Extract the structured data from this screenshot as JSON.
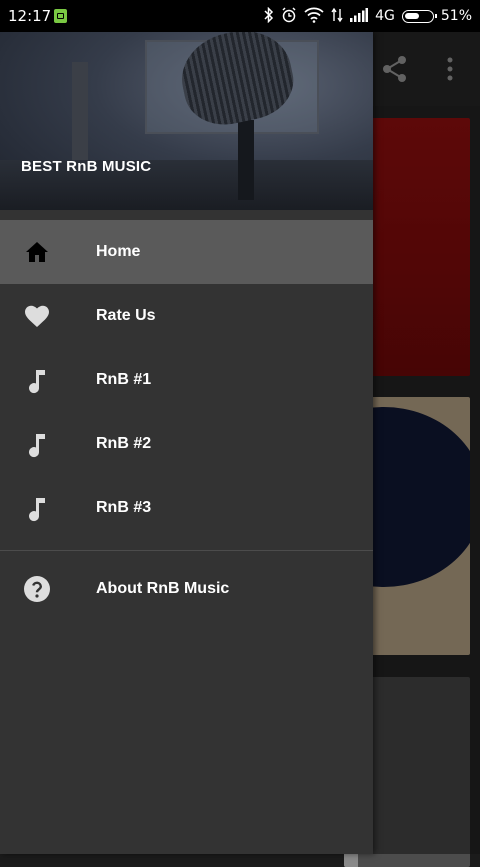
{
  "status_bar": {
    "time": "12:17",
    "network": "4G",
    "battery": "51%"
  },
  "drawer": {
    "title": "BEST RnB MUSIC",
    "items": [
      {
        "label": "Home",
        "icon": "home-icon",
        "active": true
      },
      {
        "label": "Rate Us",
        "icon": "heart-icon",
        "active": false
      },
      {
        "label": "RnB #1",
        "icon": "music-note-icon",
        "active": false
      },
      {
        "label": "RnB #2",
        "icon": "music-note-icon",
        "active": false
      },
      {
        "label": "RnB #3",
        "icon": "music-note-icon",
        "active": false
      }
    ],
    "secondary_items": [
      {
        "label": "About RnB Music",
        "icon": "help-icon"
      }
    ]
  },
  "toolbar": {
    "actions": [
      "share-icon",
      "more-vert-icon"
    ]
  },
  "colors": {
    "drawer_bg": "#333333",
    "active_item_bg": "#5a5a5a",
    "card1": "#8c0b0b",
    "card2": "#c9b493"
  }
}
